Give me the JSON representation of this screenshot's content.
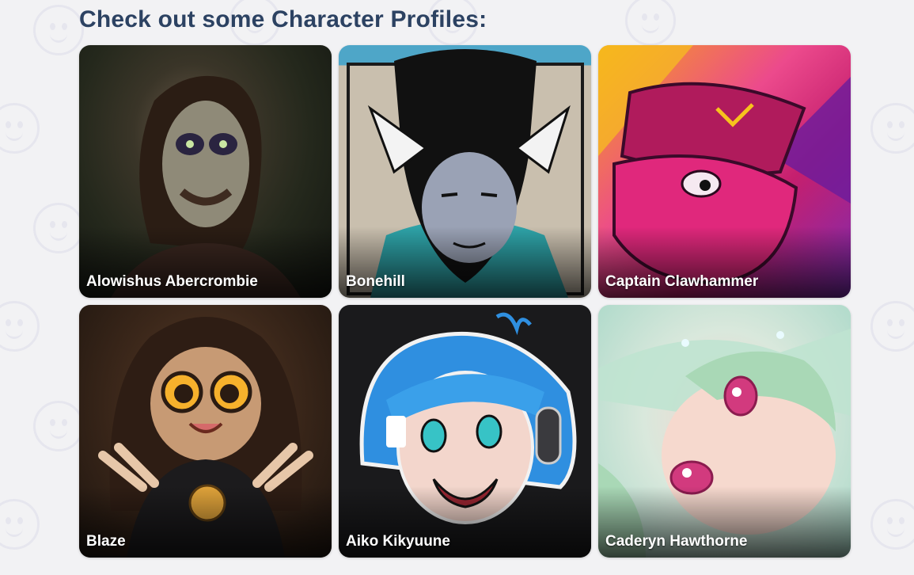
{
  "heading": "Check out some Character Profiles:",
  "characters": [
    {
      "name": "Alowishus Abercrombie"
    },
    {
      "name": "Bonehill"
    },
    {
      "name": "Captain Clawhammer"
    },
    {
      "name": "Blaze"
    },
    {
      "name": "Aiko Kikyuune"
    },
    {
      "name": "Caderyn Hawthorne"
    }
  ],
  "colors": {
    "background": "#f2f2f4",
    "heading": "#2c4262",
    "watermark": "#e6e6ee"
  },
  "background_icon": "smiley-face-icon"
}
